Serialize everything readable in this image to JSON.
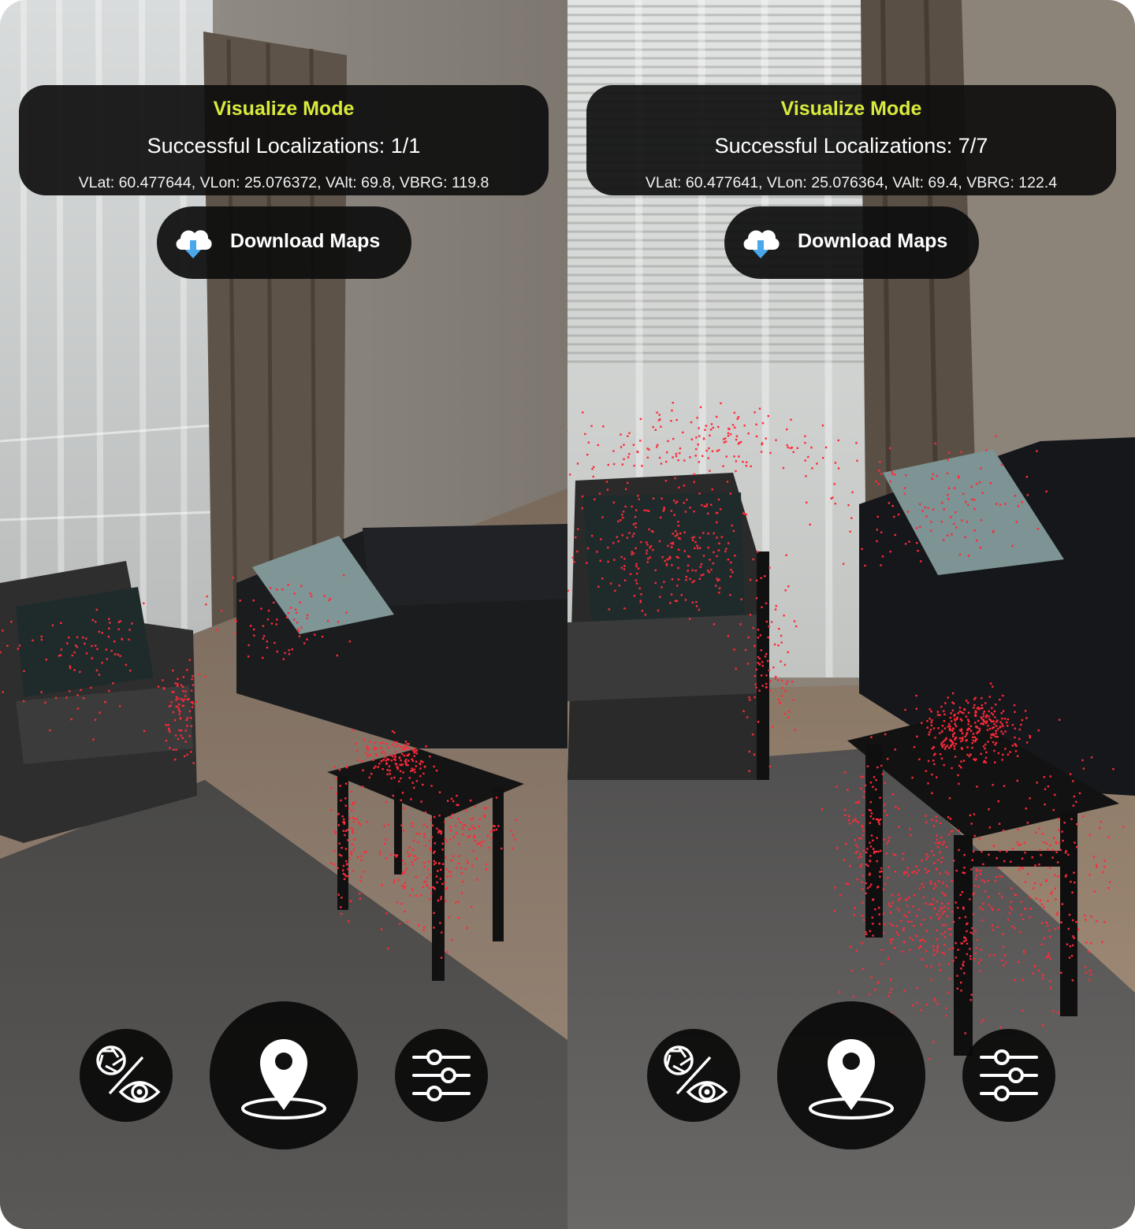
{
  "colors": {
    "mode_title": "#d9ea3c",
    "panel_bg": "#0e0e0e",
    "point_cloud": "#ff2a3a",
    "text": "#ffffff"
  },
  "screens": [
    {
      "mode_title": "Visualize Mode",
      "localizations": "Successful Localizations: 1/1",
      "coords": "VLat: 60.477644, VLon: 25.076372, VAlt: 69.8, VBRG: 119.8",
      "download_label": "Download Maps",
      "download_icon": "cloud-download-icon",
      "controls": {
        "toggle_icon": "camera-eye-toggle-icon",
        "localize_icon": "map-pin-icon",
        "settings_icon": "sliders-icon"
      }
    },
    {
      "mode_title": "Visualize Mode",
      "localizations": "Successful Localizations: 7/7",
      "coords": "VLat: 60.477641, VLon: 25.076364, VAlt: 69.4, VBRG: 122.4",
      "download_label": "Download Maps",
      "download_icon": "cloud-download-icon",
      "controls": {
        "toggle_icon": "camera-eye-toggle-icon",
        "localize_icon": "map-pin-icon",
        "settings_icon": "sliders-icon"
      }
    }
  ]
}
